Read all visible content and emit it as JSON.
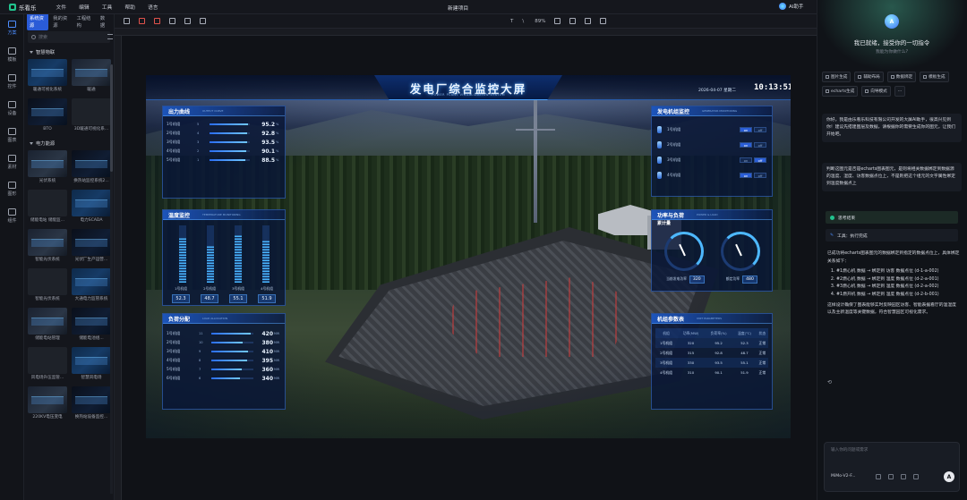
{
  "app": {
    "name": "乐看乐",
    "menu": [
      "文件",
      "编辑",
      "工具",
      "帮助",
      "语言"
    ],
    "project_title": "新建项目",
    "ai_button": "AI助手"
  },
  "sidebar_icons": [
    {
      "label": "方案",
      "icon": "monitor-icon"
    },
    {
      "label": "模板",
      "icon": "template-icon"
    },
    {
      "label": "控件",
      "icon": "widget-icon"
    },
    {
      "label": "设备",
      "icon": "device-icon"
    },
    {
      "label": "图表",
      "icon": "chart-icon"
    },
    {
      "label": "素材",
      "icon": "image-icon"
    },
    {
      "label": "图形",
      "icon": "shape-icon"
    },
    {
      "label": "组件",
      "icon": "component-icon"
    }
  ],
  "assets": {
    "tabs": [
      "系统资源",
      "我的资源",
      "工程结构",
      "数据"
    ],
    "search_placeholder": "搜索",
    "categories": [
      {
        "name": "智慧物联",
        "items": [
          "暖通可视化系统",
          "暖通",
          "BTO",
          "3D暖通可视化系..."
        ]
      },
      {
        "name": "电力能源",
        "items": [
          "光伏系统",
          "换热站监控系统2...",
          "储能电站 储能监...",
          "电力SCADA",
          "智能光伏系统",
          "光伏厂生产运营...",
          "智能光伏系统",
          "大通电力监管系统",
          "储能电站管理",
          "储能电池组...",
          "风电场升压监管...",
          "智慧风电场",
          "220KV电压变电",
          "换热站设备监控..."
        ]
      }
    ]
  },
  "toolbar": {
    "zoom": "89%"
  },
  "dashboard": {
    "title": "发电厂综合监控大屏",
    "subtitle": "POWER PLANT VISUALIZATION SYSTEM",
    "date": "2026-04-07  星期二",
    "time": "10:13:51",
    "output": {
      "title": "出力曲线",
      "en": "OUTPUT CURVE",
      "rows": [
        {
          "name": "1号机组",
          "idx": "5",
          "value": "95.2",
          "unit": "%",
          "pct": 0.952
        },
        {
          "name": "2号机组",
          "idx": "4",
          "value": "92.8",
          "unit": "%",
          "pct": 0.928
        },
        {
          "name": "3号机组",
          "idx": "3",
          "value": "93.5",
          "unit": "%",
          "pct": 0.935
        },
        {
          "name": "4号机组",
          "idx": "2",
          "value": "90.1",
          "unit": "%",
          "pct": 0.901
        },
        {
          "name": "5号机组",
          "idx": "1",
          "value": "88.5",
          "unit": "%",
          "pct": 0.885
        }
      ]
    },
    "temp": {
      "title": "温度监控",
      "en": "TEMPERATURE MONITORING",
      "units": [
        {
          "name": "1号机组",
          "value": "52.3",
          "pct": 0.78
        },
        {
          "name": "2号机组",
          "value": "48.7",
          "pct": 0.64
        },
        {
          "name": "3号机组",
          "value": "55.1",
          "pct": 0.84
        },
        {
          "name": "4号机组",
          "value": "51.9",
          "pct": 0.74
        }
      ]
    },
    "load": {
      "title": "负荷分配",
      "en": "LOAD ALLOCATION",
      "rows": [
        {
          "name": "1号机组",
          "idx": "11",
          "value": "420",
          "unit": "MW",
          "pct": 0.93
        },
        {
          "name": "2号机组",
          "idx": "10",
          "value": "380",
          "unit": "MW",
          "pct": 0.75
        },
        {
          "name": "3号机组",
          "idx": "9",
          "value": "410",
          "unit": "MW",
          "pct": 0.88
        },
        {
          "name": "4号机组",
          "idx": "8",
          "value": "395",
          "unit": "MW",
          "pct": 0.85
        },
        {
          "name": "5号机组",
          "idx": "7",
          "value": "360",
          "unit": "MW",
          "pct": 0.72
        },
        {
          "name": "6号机组",
          "idx": "6",
          "value": "340",
          "unit": "MW",
          "pct": 0.68
        }
      ]
    },
    "fans": {
      "title": "发电机组监控",
      "en": "GENERATOR MONITORING",
      "rows": [
        {
          "name": "1号机组",
          "on": "on",
          "off": "off",
          "state": "on"
        },
        {
          "name": "2号机组",
          "on": "on",
          "off": "off",
          "state": "on"
        },
        {
          "name": "3号机组",
          "on": "on",
          "off": "off",
          "state": "off"
        },
        {
          "name": "4号机组",
          "on": "on",
          "off": "off",
          "state": "on"
        }
      ]
    },
    "power": {
      "title": "功率与负荷",
      "title2": "累计量",
      "en": "POWER & LOAD",
      "current_label": "当前发电功率",
      "current_value": "320",
      "rated_label": "额定功率",
      "rated_value": "480"
    },
    "table": {
      "title": "机组参数表",
      "en": "UNIT PARAMETERS",
      "headers": [
        "机组",
        "功率(MW)",
        "负荷率(%)",
        "温度(°C)",
        "状态"
      ],
      "rows": [
        [
          "1号机组",
          "320",
          "95.2",
          "52.3",
          "正常"
        ],
        [
          "2号机组",
          "315",
          "92.8",
          "48.7",
          "正常"
        ],
        [
          "3号机组",
          "330",
          "93.5",
          "55.1",
          "正常"
        ],
        [
          "4号机组",
          "310",
          "90.1",
          "51.9",
          "正常"
        ]
      ]
    }
  },
  "ai_panel": {
    "greeting": "我已就绪，接受你的一切指令",
    "subgreeting": "我能为你做什么?",
    "chips": [
      "图片生成",
      "辅助布局",
      "数据绑定",
      "模板生成",
      "echarts生成",
      "向导模式",
      "···"
    ],
    "intro": "你好，我是由乐看乐科技有限公司开发的大屏AI助手，很高兴见到你！建议先搭建图层及数据，请根据你的需要生成你的图元，让我们开始吧。",
    "user_msg": "判断这图元是否是echarts图表图元，是则将相关数据绑定到数据源的温度、湿度、访客数据点位上，不是则把这个组元的文字属性绑定到温度数据点上",
    "thinking": "思考结束",
    "tool": "工具：执行完成",
    "answer_intro": "已成功将echarts图表图元的数据绑定到指定的数据点位上，具体绑定关系如下：",
    "answer_items": [
      "#1燃心机 数据 → 绑定到 访客 数据点位 (d-1-a-002)",
      "#2燃心机 数据 → 绑定到 温度 数据点位 (d-2-a-001)",
      "#3燃心机 数据 → 绑定到 温度 数据点位 (d-2-a-002)",
      "#1燃开机 数据 → 绑定到 温度 数据点位 (d-2-b-001)"
    ],
    "answer_outro": "这样设计确保了图表能够实时反映园区访客、智能表据看厅的温湿度以及主新温度等关键数据，符合智慧园区可视化需求。",
    "input_placeholder": "输入你的问题或需求",
    "model": "MiMo-V2-F..."
  }
}
